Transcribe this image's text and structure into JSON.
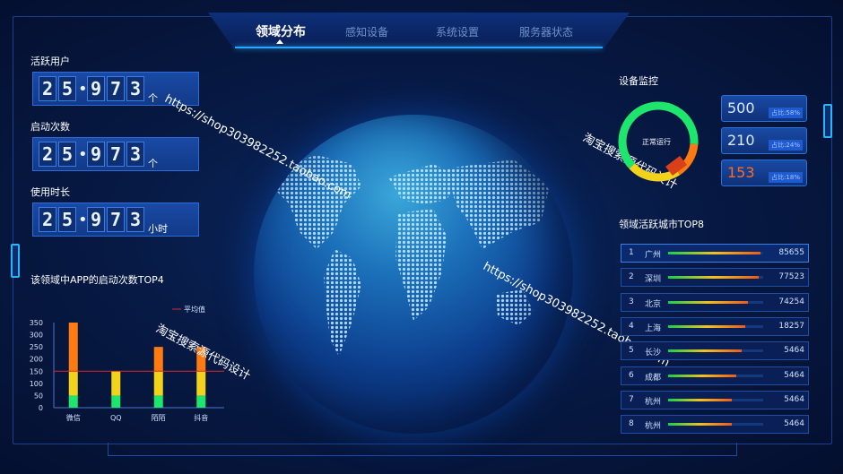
{
  "nav": {
    "items": [
      "领域分布",
      "感知设备",
      "系统设置",
      "服务器状态"
    ],
    "active": 0
  },
  "left": {
    "metrics": [
      {
        "label": "活跃用户",
        "digits": [
          "2",
          "5",
          "9",
          "7",
          "3"
        ],
        "unit": "个"
      },
      {
        "label": "启动次数",
        "digits": [
          "2",
          "5",
          "9",
          "7",
          "3"
        ],
        "unit": "个"
      },
      {
        "label": "使用时长",
        "digits": [
          "2",
          "5",
          "9",
          "7",
          "3"
        ],
        "unit": "小时"
      }
    ],
    "chart_title": "该领域中APP的启动次数TOP4"
  },
  "watermarks": [
    "https://shop303982252.taobao.com",
    "淘宝搜索源代码设计",
    "https://shop303982252.taobao.com",
    "淘宝搜索源代码设计"
  ],
  "right": {
    "monitor_title": "设备监控",
    "gauge_label": "正常运行",
    "legend": [
      {
        "value": "500",
        "pct": "占比:58%",
        "color": "#dbe9ff"
      },
      {
        "value": "210",
        "pct": "占比:24%",
        "color": "#dbe9ff"
      },
      {
        "value": "153",
        "pct": "占比:18%",
        "color": "#ff6a1e"
      }
    ],
    "rank_title": "领域活跃城市TOP8",
    "ranks": [
      {
        "num": "1",
        "city": "广州",
        "score": "85655",
        "fill": 0.97
      },
      {
        "num": "2",
        "city": "深圳",
        "score": "77523",
        "fill": 0.95
      },
      {
        "num": "3",
        "city": "北京",
        "score": "74254",
        "fill": 0.84
      },
      {
        "num": "4",
        "city": "上海",
        "score": "18257",
        "fill": 0.81
      },
      {
        "num": "5",
        "city": "长沙",
        "score": "5464",
        "fill": 0.77
      },
      {
        "num": "6",
        "city": "成都",
        "score": "5464",
        "fill": 0.72
      },
      {
        "num": "7",
        "city": "杭州",
        "score": "5464",
        "fill": 0.67
      },
      {
        "num": "8",
        "city": "杭州",
        "score": "5464",
        "fill": 0.67
      }
    ]
  },
  "colors": {
    "accent": "#28a8ff",
    "green": "#1ee56b",
    "yellow": "#f3d21c",
    "orange": "#ff7a10",
    "red": "#d8282a"
  },
  "chart_data": {
    "type": "bar",
    "categories": [
      "微信",
      "QQ",
      "陌陌",
      "抖音"
    ],
    "stacked": true,
    "series": [
      {
        "values": [
          50,
          50,
          50,
          50
        ],
        "color": "#1ee56b"
      },
      {
        "values": [
          100,
          100,
          100,
          100
        ],
        "color": "#f3d21c"
      },
      {
        "values": [
          200,
          0,
          100,
          100
        ],
        "color": "#ff7a10"
      }
    ],
    "totals": [
      350,
      150,
      250,
      250
    ],
    "average_line": {
      "name": "平均值",
      "value": 150,
      "color": "#d8282a"
    },
    "y_ticks": [
      "0",
      "50",
      "100",
      "150",
      "200",
      "250",
      "300",
      "350"
    ],
    "ylim": [
      0,
      350
    ],
    "legend_position": "top-right"
  }
}
